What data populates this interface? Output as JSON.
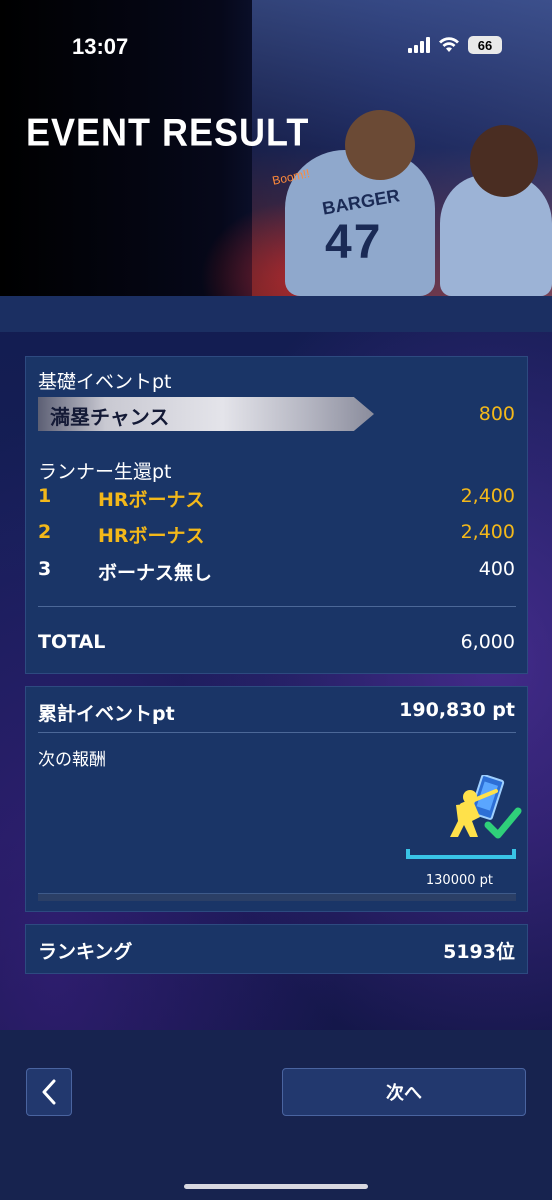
{
  "status_bar": {
    "time": "13:07",
    "battery": "66",
    "signal_icon": "signal-icon",
    "wifi_icon": "wifi-icon"
  },
  "banner": {
    "title": "EVENT RESULT",
    "jersey_name": "BARGER",
    "jersey_number": "47",
    "boom_text": "Boom!!"
  },
  "base_event": {
    "label": "基礎イベントpt",
    "bonus_name": "満塁チャンス",
    "bonus_value": "800",
    "runner_label": "ランナー生還pt",
    "rows": [
      {
        "num": "1",
        "name": "HRボーナス",
        "value": "2,400",
        "highlight": true
      },
      {
        "num": "2",
        "name": "HRボーナス",
        "value": "2,400",
        "highlight": true
      },
      {
        "num": "3",
        "name": "ボーナス無し",
        "value": "400",
        "highlight": false
      }
    ],
    "total_label": "TOTAL",
    "total_value": "6,000"
  },
  "cumulative": {
    "label": "累計イベントpt",
    "value": "190,830 pt",
    "next_reward_label": "次の報酬",
    "reward_target": "130000 pt",
    "reward_icon": "batter-card-check-icon",
    "progress": 1.0
  },
  "ranking": {
    "label": "ランキング",
    "value": "5193位"
  },
  "nav": {
    "back_icon": "chevron-left-icon",
    "next_label": "次へ"
  },
  "colors": {
    "accent_gold": "#f3b81a",
    "panel_bg": "#1a3567",
    "progress_cyan": "#39c4e6",
    "check_green": "#2fd07a"
  }
}
